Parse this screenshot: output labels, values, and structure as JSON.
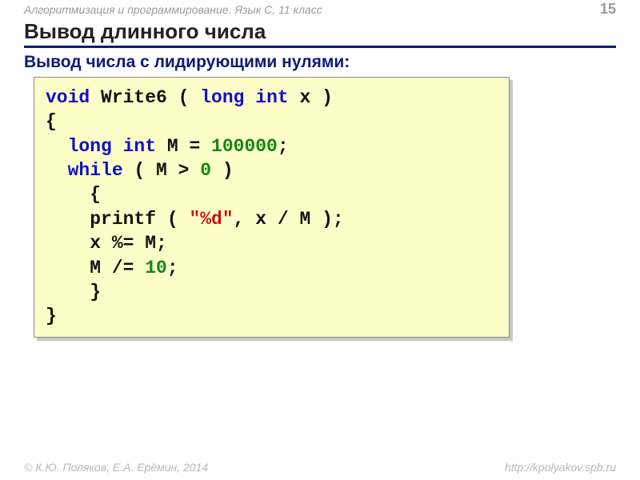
{
  "header": {
    "text": "Алгоритмизация и программирование. Язык С, 11 класс",
    "page_number": "15"
  },
  "title": "Вывод длинного числа",
  "subtitle": "Вывод числа с лидирующими нулями:",
  "code": {
    "l1_kw_void": "void",
    "l1_fn": " Write6 ( ",
    "l1_kw_li": "long int",
    "l1_rest": " x )",
    "l2": "{",
    "l3_pad": "  ",
    "l3_kw_li": "long int",
    "l3_mid": " M = ",
    "l3_num": "100000",
    "l3_end": ";",
    "l4_pad": "  ",
    "l4_kw": "while",
    "l4_mid": " ( M > ",
    "l4_num": "0",
    "l4_end": " )",
    "l5": "    {",
    "l6_pad": "    ",
    "l6_fn": "printf ( ",
    "l6_str": "\"%d\"",
    "l6_end": ", x / M );",
    "l7": "    x %= M;",
    "l8_pad": "    M /= ",
    "l8_num": "10",
    "l8_end": ";",
    "l9": "    }",
    "l10": "}"
  },
  "footer": {
    "left": "© К.Ю. Поляков, Е.А. Ерёмин, 2014",
    "right": "http://kpolyakov.spb.ru"
  }
}
